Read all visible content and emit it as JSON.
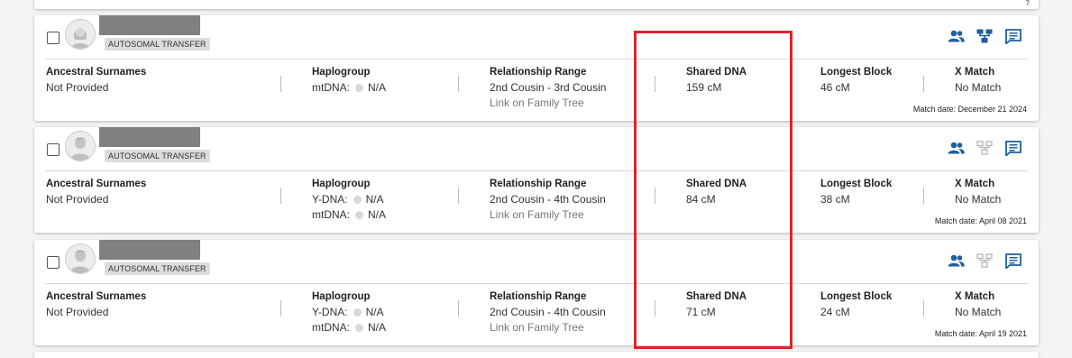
{
  "labels": {
    "surnames": "Ancestral Surnames",
    "haplogroup": "Haplogroup",
    "relationship": "Relationship Range",
    "shared_dna": "Shared DNA",
    "longest_block": "Longest Block",
    "x_match": "X Match",
    "ydna": "Y-DNA:",
    "mtdna": "mtDNA:",
    "family_tree_link": "Link on Family Tree"
  },
  "top_stub_glyph": "?",
  "icons": [
    "matches-icon",
    "family-tree-icon",
    "notes-icon"
  ],
  "colors": {
    "icon_blue": "#1f5f9e",
    "icon_gray": "#b5b5b5",
    "highlight": "#e0242c"
  },
  "matches": [
    {
      "badge": "AUTOSOMAL TRANSFER",
      "avatar": "female",
      "surnames": "Not Provided",
      "mtdna": "N/A",
      "relationship": "2nd Cousin - 3rd Cousin",
      "shared_dna": "159 cM",
      "longest_block": "46 cM",
      "x_match": "No Match",
      "match_date": "Match date: December 21 2024",
      "tree_linked": true
    },
    {
      "badge": "AUTOSOMAL TRANSFER",
      "avatar": "male",
      "surnames": "Not Provided",
      "ydna": "N/A",
      "mtdna": "N/A",
      "relationship": "2nd Cousin - 4th Cousin",
      "shared_dna": "84 cM",
      "longest_block": "38 cM",
      "x_match": "No Match",
      "match_date": "Match date: April 08 2021",
      "tree_linked": false
    },
    {
      "badge": "AUTOSOMAL TRANSFER",
      "avatar": "male",
      "surnames": "Not Provided",
      "ydna": "N/A",
      "mtdna": "N/A",
      "relationship": "2nd Cousin - 4th Cousin",
      "shared_dna": "71 cM",
      "longest_block": "24 cM",
      "x_match": "No Match",
      "match_date": "Match date: April 19 2021",
      "tree_linked": false
    }
  ]
}
